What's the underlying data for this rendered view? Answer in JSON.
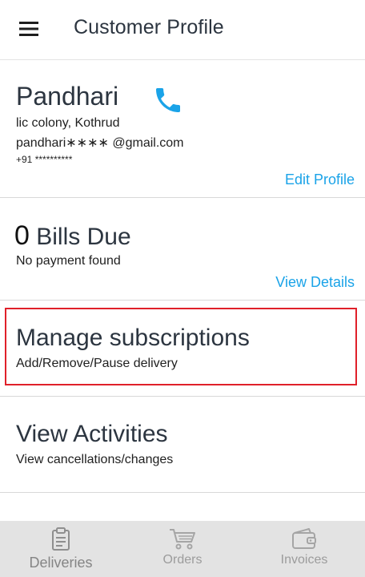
{
  "header": {
    "title": "Customer Profile",
    "menu_icon": "hamburger-menu-icon"
  },
  "profile": {
    "name": "Pandhari",
    "address": "lic colony, Kothrud",
    "email": "pandhari∗∗∗∗ @gmail.com",
    "phone": "+91 **********",
    "edit_label": "Edit Profile",
    "phone_icon": "phone-icon"
  },
  "bills": {
    "count": "0",
    "label": " Bills Due",
    "subtitle": "No payment found",
    "details_label": "View Details"
  },
  "subscriptions": {
    "title": "Manage subscriptions",
    "subtitle": "Add/Remove/Pause delivery"
  },
  "activities": {
    "title": "View Activities",
    "subtitle": "View cancellations/changes"
  },
  "bottom_nav": {
    "items": [
      {
        "label": "Deliveries",
        "icon": "clipboard-icon"
      },
      {
        "label": "Orders",
        "icon": "cart-icon"
      },
      {
        "label": "Invoices",
        "icon": "wallet-icon"
      }
    ]
  },
  "colors": {
    "accent": "#1aa3e8",
    "highlight": "#e0202a",
    "nav_background": "#e3e3e3"
  }
}
